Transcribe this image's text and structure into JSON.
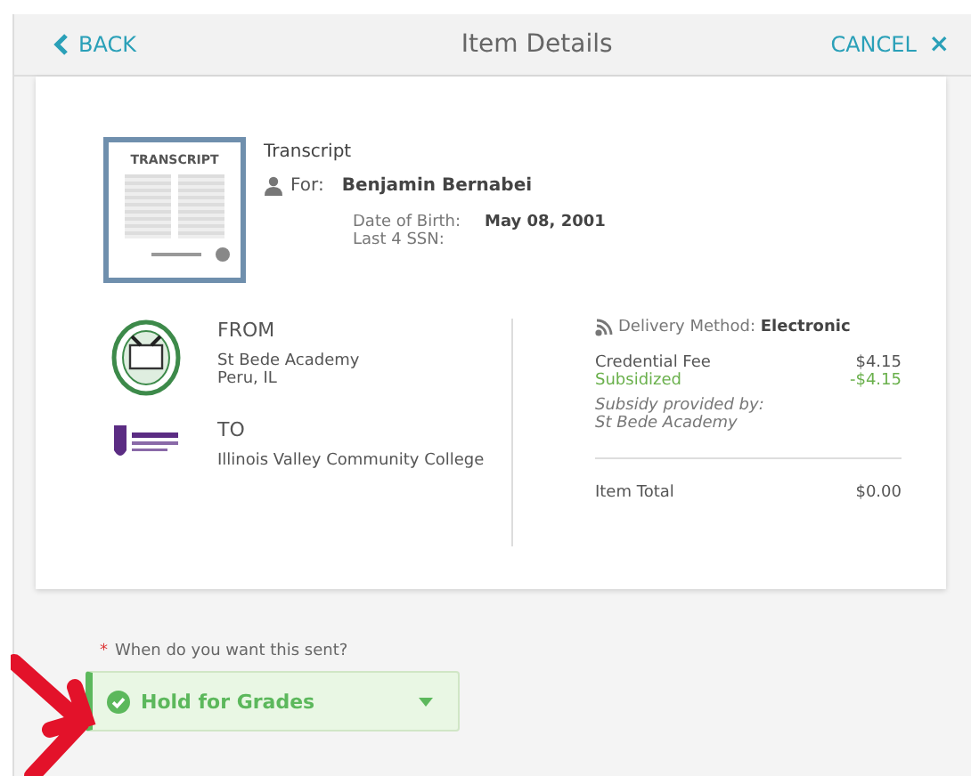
{
  "header": {
    "back": "BACK",
    "title": "Item Details",
    "cancel": "CANCEL",
    "close_glyph": "×"
  },
  "item": {
    "thumbnail_label": "TRANSCRIPT",
    "type": "Transcript",
    "for_label": "For:",
    "for_name": "Benjamin Bernabei",
    "details": [
      {
        "label": "Date of Birth:",
        "value": "May 08, 2001"
      },
      {
        "label": "Last 4 SSN:"
      }
    ]
  },
  "from": {
    "heading": "FROM",
    "name": "St Bede Academy",
    "location": "Peru, IL"
  },
  "to": {
    "heading": "TO",
    "name": "Illinois Valley Community College"
  },
  "delivery": {
    "label": "Delivery Method:",
    "value": "Electronic"
  },
  "fees": [
    {
      "label": "Credential Fee",
      "amount": "$4.15",
      "kind": "charge"
    },
    {
      "label": "Subsidized",
      "amount": "-$4.15",
      "kind": "discount"
    }
  ],
  "subsidy_note": [
    "Subsidy provided by:",
    "St Bede Academy"
  ],
  "total": {
    "label": "Item Total",
    "amount": "$0.00"
  },
  "timing": {
    "required_mark": "*",
    "label": "When do you want this sent?",
    "value": "Hold for Grades",
    "valid": true
  }
}
